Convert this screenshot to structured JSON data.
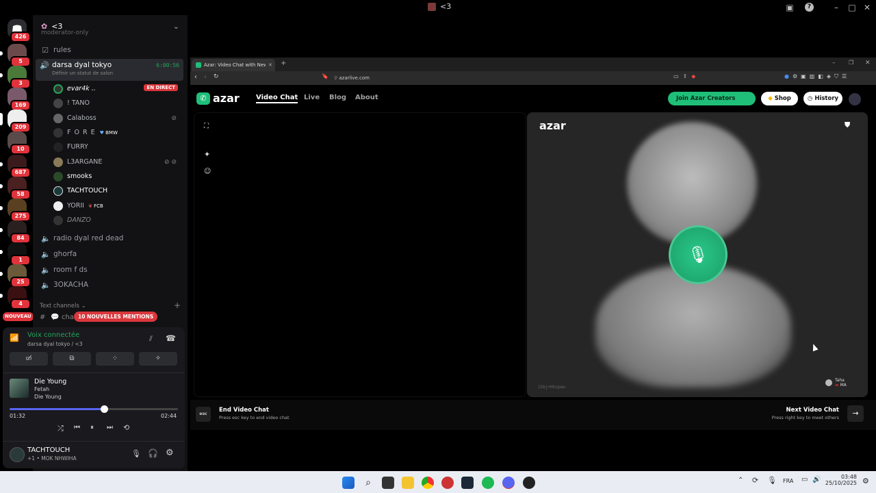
{
  "window": {
    "title": "<3"
  },
  "servers": [
    {
      "badge": "426"
    },
    {
      "badge": "5"
    },
    {
      "badge": "3"
    },
    {
      "badge": "169"
    },
    {
      "badge": "209"
    },
    {
      "badge": "10"
    },
    {
      "badge": "687"
    },
    {
      "badge": "58"
    },
    {
      "badge": "275"
    },
    {
      "badge": "84"
    },
    {
      "badge": "1"
    },
    {
      "badge": "25"
    },
    {
      "badge": "4"
    }
  ],
  "server_badges": {
    "nouveau": "NOUVEAU"
  },
  "channel_header": {
    "name": "<3"
  },
  "channels": {
    "partial": "moderator-only",
    "rules": "rules",
    "active_voice": "darsa dyal tokyo",
    "active_timer": "6:00:56",
    "active_status_placeholder": "Définir un statut de salon",
    "voice_channels": [
      "radio dyal red dead",
      "ghorfa",
      "room f ds",
      "3OKACHA"
    ],
    "text_channels_label": "Text channels",
    "chat_partial": "cha",
    "mentions_pill": "10 NOUVELLES MENTIONS"
  },
  "members": [
    {
      "name": "evar4k ..",
      "badge": "EN DIRECT"
    },
    {
      "name": "! TANO"
    },
    {
      "name": "Calaboss"
    },
    {
      "name": "F O R E",
      "tag": "BMW"
    },
    {
      "name": "FURRY"
    },
    {
      "name": "L3ARGANE"
    },
    {
      "name": "smooks"
    },
    {
      "name": "TACHTOUCH"
    },
    {
      "name": "YORII",
      "tag": "FCB"
    },
    {
      "name": "DANZO"
    }
  ],
  "voice_status": {
    "title": "Voix connectée",
    "subtitle": "darsa dyal tokyo / <3"
  },
  "player": {
    "track": "Die Young",
    "artist": "Fetah",
    "album": "Die Young",
    "elapsed": "01:32",
    "duration": "02:44",
    "progress": 0.56
  },
  "user": {
    "name": "TACHTOUCH",
    "status": "+1 • MOK NHWIHA"
  },
  "browser": {
    "tab_title": "Azar: Video Chat with New Pe",
    "url": "azarlive.com"
  },
  "azar": {
    "logo": "azar",
    "nav": [
      "Video Chat",
      "Live",
      "Blog",
      "About"
    ],
    "buttons": {
      "creators": "Join Azar Creators",
      "shop": "Shop",
      "history": "History"
    },
    "watermark": "azar",
    "peer_code": "15bj+Hhzpew",
    "peer_name": "Taha",
    "peer_tag": "MA",
    "end": {
      "key": "esc",
      "title": "End Video Chat",
      "subtitle": "Press esc key to end video chat"
    },
    "next": {
      "title": "Next Video Chat",
      "subtitle": "Press right key to meet others"
    }
  },
  "taskbar": {
    "lang": "FRA",
    "time": "03:48",
    "date": "25/10/2025"
  },
  "colors": {
    "accent_green": "#1fbf79",
    "discord_red": "#da373c",
    "voice_green": "#23a55a"
  }
}
